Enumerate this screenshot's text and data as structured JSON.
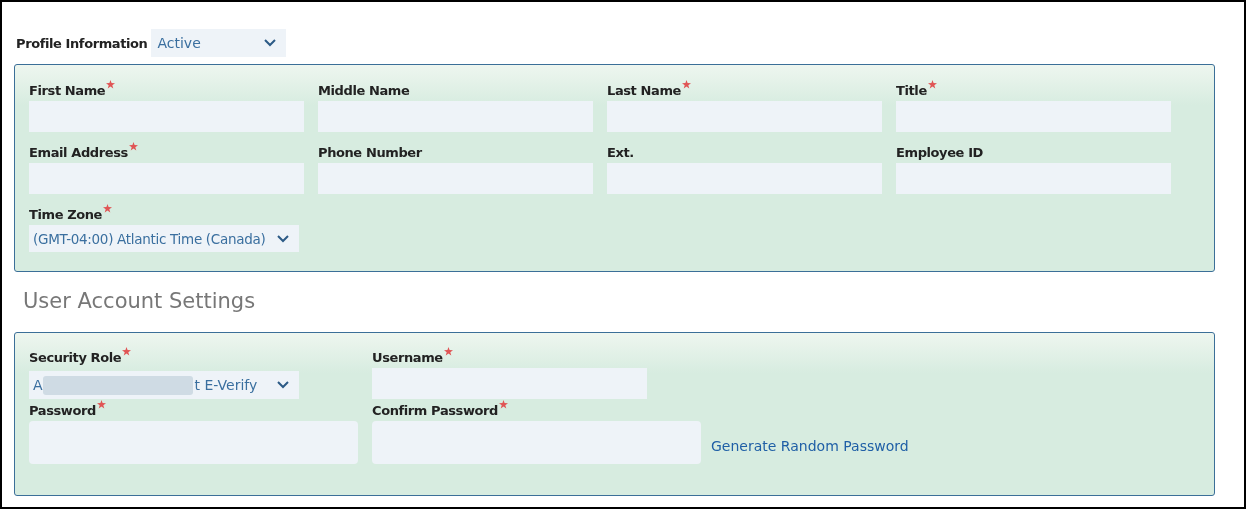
{
  "profile_information": {
    "label": "Profile Information",
    "status": {
      "value": "Active"
    }
  },
  "profile_fields": [
    {
      "label": "First Name",
      "required": true,
      "kind": "text"
    },
    {
      "label": "Middle Name",
      "required": false,
      "kind": "text"
    },
    {
      "label": "Last Name",
      "required": true,
      "kind": "text"
    },
    {
      "label": "Title",
      "required": true,
      "kind": "text"
    },
    {
      "label": "Email Address",
      "required": true,
      "kind": "text"
    },
    {
      "label": "Phone Number",
      "required": false,
      "kind": "text"
    },
    {
      "label": "Ext.",
      "required": false,
      "kind": "text"
    },
    {
      "label": "Employee ID",
      "required": false,
      "kind": "text"
    },
    {
      "label": "Time Zone",
      "required": true,
      "kind": "select",
      "value": "(GMT-04:00) Atlantic Time (Canada)"
    }
  ],
  "user_account_settings": {
    "heading": "User Account Settings",
    "fields": [
      {
        "label": "Security Role",
        "required": true,
        "kind": "select",
        "value_start": "A",
        "redacted": true,
        "value_end": "t E-Verify"
      },
      {
        "label": "Username",
        "required": true,
        "kind": "text"
      },
      {
        "label": "Password",
        "required": true,
        "kind": "password"
      },
      {
        "label": "Confirm Password",
        "required": true,
        "kind": "password"
      }
    ],
    "link": "Generate Random Password"
  }
}
